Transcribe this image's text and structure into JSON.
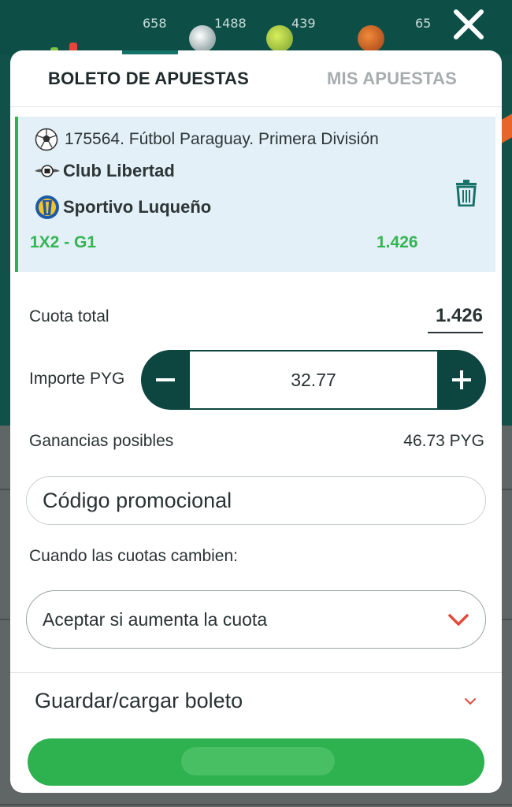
{
  "background": {
    "counts": [
      "658",
      "1488",
      "439",
      "65"
    ]
  },
  "tabs": {
    "active": "BOLETO DE APUESTAS",
    "inactive": "MIS APUESTAS"
  },
  "event": {
    "title": "175564. Fútbol Paraguay. Primera División",
    "team1": "Club Libertad",
    "team2": "Sportivo Luqueño",
    "market": "1X2 - G1",
    "odds": "1.426"
  },
  "summary": {
    "total_label": "Cuota total",
    "total_value": "1.426",
    "amount_label": "Importe PYG",
    "amount_value": "32.77",
    "winnings_label": "Ganancias posibles",
    "winnings_value": "46.73 PYG"
  },
  "promo": {
    "placeholder": "Código promocional"
  },
  "odds_change": {
    "label": "Cuando las cuotas cambien:",
    "selected": "Aceptar si aumenta la cuota"
  },
  "save": {
    "label": "Guardar/cargar boleto"
  },
  "colors": {
    "primary_dark": "#0d4641",
    "accent_green": "#2eb14f",
    "card_bg": "#e3f0f8",
    "chevron_red": "#e14b3b"
  }
}
